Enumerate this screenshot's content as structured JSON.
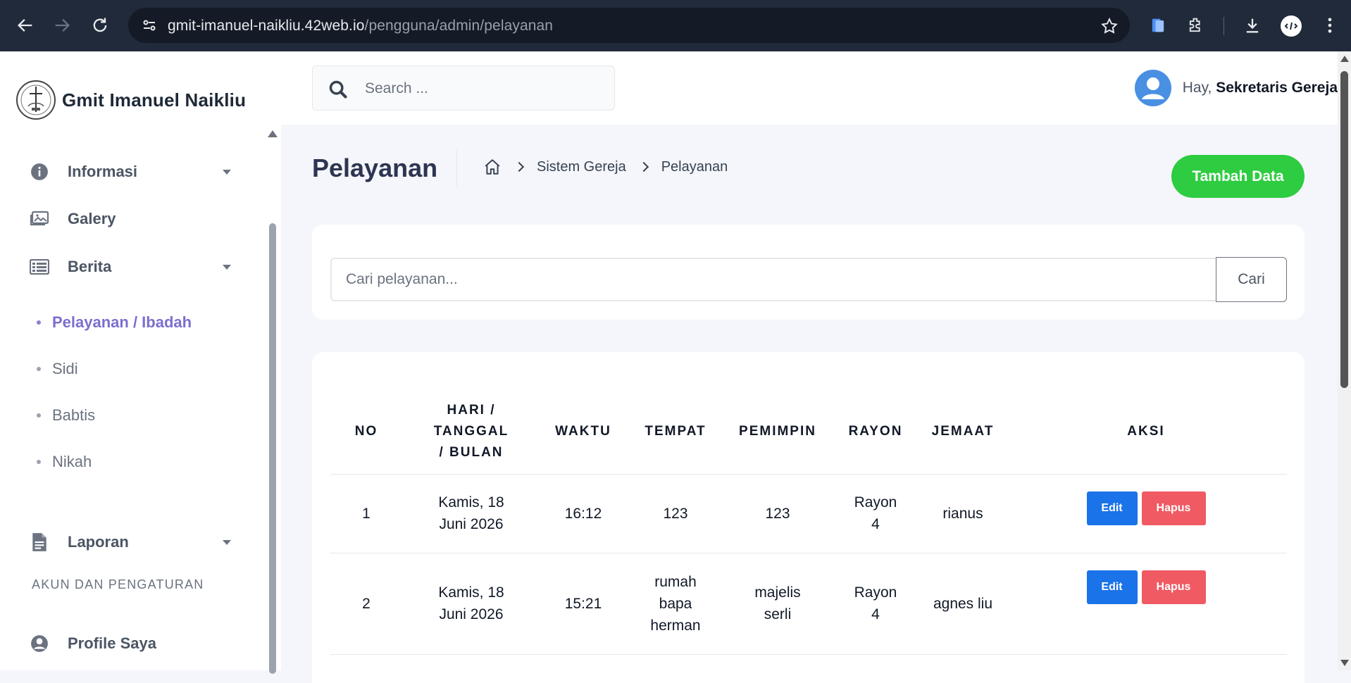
{
  "browser": {
    "url_host": "gmit-imanuel-naikliu.42web.io",
    "url_path": "/pengguna/admin/pelayanan"
  },
  "sidebar": {
    "brand_name": "Gmit Imanuel Naikliu",
    "menu": [
      {
        "label": "Informasi",
        "icon": "info-icon"
      },
      {
        "label": "Galery",
        "icon": "gallery-icon"
      },
      {
        "label": "Berita",
        "icon": "news-icon"
      }
    ],
    "submenu": [
      {
        "label": "Pelayanan / Ibadah",
        "active": true
      },
      {
        "label": "Sidi",
        "active": false
      },
      {
        "label": "Babtis",
        "active": false
      },
      {
        "label": "Nikah",
        "active": false
      }
    ],
    "laporan_label": "Laporan",
    "section_title": "AKUN DAN PENGATURAN",
    "profile_label": "Profile Saya",
    "active_color": "#7b6fcf"
  },
  "header": {
    "search_placeholder": "Search ...",
    "greeting": "Hay,",
    "user_name": "Sekretaris Gereja"
  },
  "page": {
    "title": "Pelayanan",
    "breadcrumb": [
      "Sistem Gereja",
      "Pelayanan"
    ],
    "add_button": "Tambah Data",
    "add_button_color": "#2ecc40"
  },
  "filter": {
    "placeholder": "Cari pelayanan...",
    "button": "Cari"
  },
  "table": {
    "headers": {
      "no": "NO",
      "date_line1": "HARI /",
      "date_line2": "TANGGAL",
      "date_line3": "/ BULAN",
      "time": "WAKTU",
      "place": "TEMPAT",
      "leader": "PEMIMPIN",
      "rayon": "RAYON",
      "member": "JEMAAT",
      "action": "AKSI"
    },
    "rows": [
      {
        "no": "1",
        "date_a": "Kamis, 18",
        "date_b": "Juni 2026",
        "time": "16:12",
        "place_a": "123",
        "place_b": "",
        "place_c": "",
        "leader_a": "123",
        "leader_b": "",
        "rayon_a": "Rayon",
        "rayon_b": "4",
        "member": "rianus"
      },
      {
        "no": "2",
        "date_a": "Kamis, 18",
        "date_b": "Juni 2026",
        "time": "15:21",
        "place_a": "rumah",
        "place_b": "bapa",
        "place_c": "herman",
        "leader_a": "majelis",
        "leader_b": "serli",
        "rayon_a": "Rayon",
        "rayon_b": "4",
        "member": "agnes liu"
      }
    ],
    "edit_label": "Edit",
    "delete_label": "Hapus",
    "edit_color": "#1a73e8",
    "delete_color": "#f05a63"
  }
}
